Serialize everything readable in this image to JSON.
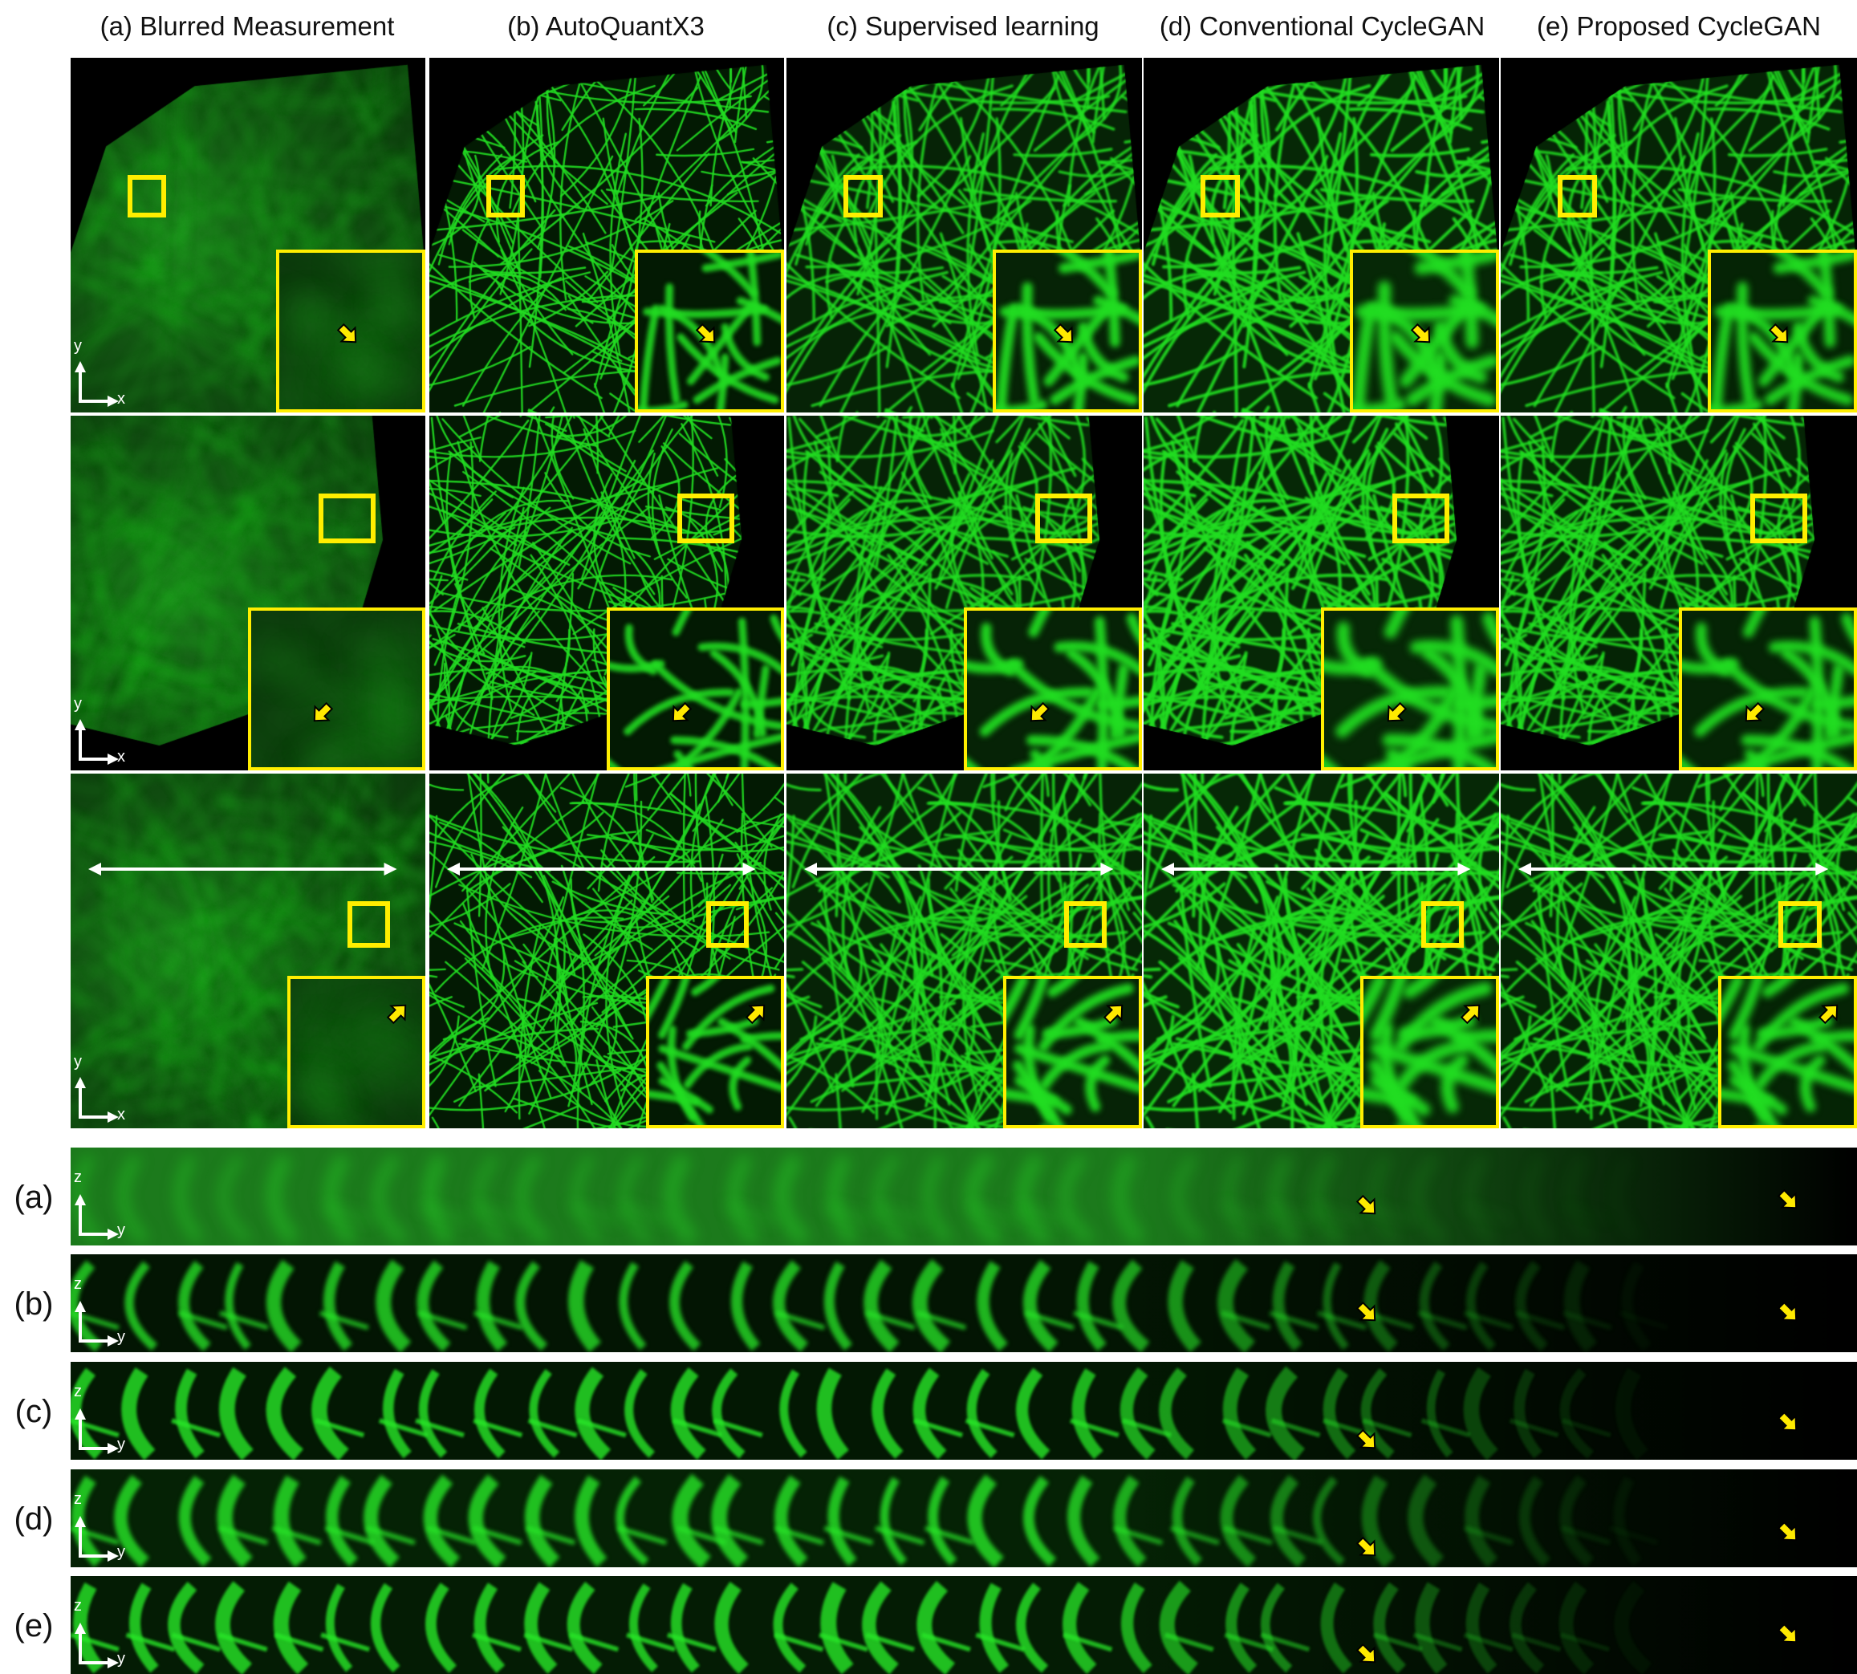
{
  "columns": [
    {
      "id": "a",
      "label": "(a) Blurred Measurement"
    },
    {
      "id": "b",
      "label": "(b) AutoQuantX3"
    },
    {
      "id": "c",
      "label": "(c) Supervised learning"
    },
    {
      "id": "d",
      "label": "(d) Conventional  CycleGAN"
    },
    {
      "id": "e",
      "label": "(e) Proposed CycleGAN"
    }
  ],
  "lateral_axes": {
    "vertical": "y",
    "horizontal": "x"
  },
  "axial_axes": {
    "vertical": "z",
    "horizontal": "y"
  },
  "axial_rows": [
    {
      "id": "a",
      "label": "(a)"
    },
    {
      "id": "b",
      "label": "(b)"
    },
    {
      "id": "c",
      "label": "(c)"
    },
    {
      "id": "d",
      "label": "(d)"
    },
    {
      "id": "e",
      "label": "(e)"
    }
  ],
  "colors": {
    "signal_green": "#22dd22",
    "roi_yellow": "#ffee00",
    "arrow_yellow": "#ffea00",
    "background": "#000000"
  }
}
